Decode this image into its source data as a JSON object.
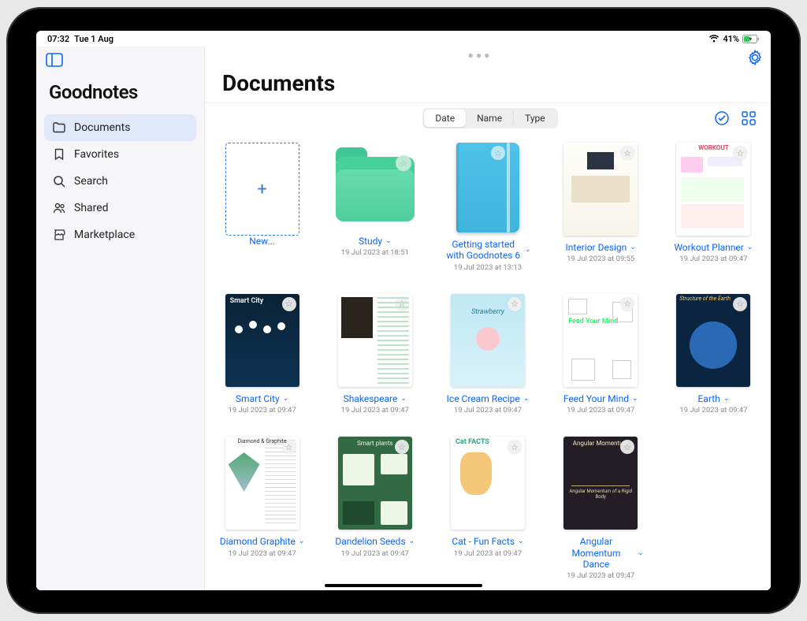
{
  "status": {
    "time": "07:32",
    "date": "Tue 1 Aug",
    "battery": "41%"
  },
  "app_title": "Goodnotes",
  "page_title": "Documents",
  "sidebar": {
    "items": [
      {
        "label": "Documents",
        "icon": "folder-icon",
        "active": true
      },
      {
        "label": "Favorites",
        "icon": "bookmark-icon",
        "active": false
      },
      {
        "label": "Search",
        "icon": "search-icon",
        "active": false
      },
      {
        "label": "Shared",
        "icon": "people-icon",
        "active": false
      },
      {
        "label": "Marketplace",
        "icon": "storefront-icon",
        "active": false
      }
    ]
  },
  "sort_tabs": {
    "options": [
      "Date",
      "Name",
      "Type"
    ],
    "selected": "Date"
  },
  "toolbar": {
    "select_label": "Select",
    "view_grid_label": "Grid"
  },
  "new_item": {
    "label": "New..."
  },
  "documents": [
    {
      "title": "Study",
      "date": "19 Jul 2023 at 18:51",
      "kind": "folder"
    },
    {
      "title": "Getting started with Goodnotes 6",
      "date": "19 Jul 2023 at 13:13",
      "kind": "notebook"
    },
    {
      "title": "Interior Design",
      "date": "19 Jul 2023 at 09:55",
      "kind": "page",
      "variant": "interior"
    },
    {
      "title": "Workout Planner",
      "date": "19 Jul 2023 at 09:47",
      "kind": "page",
      "variant": "workout"
    },
    {
      "title": "Smart City",
      "date": "19 Jul 2023 at 09:47",
      "kind": "page",
      "variant": "smart"
    },
    {
      "title": "Shakespeare",
      "date": "19 Jul 2023 at 09:47",
      "kind": "page",
      "variant": "shakes"
    },
    {
      "title": "Ice Cream Recipe",
      "date": "19 Jul 2023 at 09:47",
      "kind": "page",
      "variant": "ice"
    },
    {
      "title": "Feed Your Mind",
      "date": "19 Jul 2023 at 09:47",
      "kind": "page",
      "variant": "feed"
    },
    {
      "title": "Earth",
      "date": "19 Jul 2023 at 09:47",
      "kind": "page",
      "variant": "earth"
    },
    {
      "title": "Diamond Graphite",
      "date": "19 Jul 2023 at 09:47",
      "kind": "page",
      "variant": "diamond"
    },
    {
      "title": "Dandelion Seeds",
      "date": "19 Jul 2023 at 09:47",
      "kind": "page",
      "variant": "seeds"
    },
    {
      "title": "Cat - Fun Facts",
      "date": "19 Jul 2023 at 09:47",
      "kind": "page",
      "variant": "cat"
    },
    {
      "title": "Angular Momentum Dance",
      "date": "19 Jul 2023 at 09:47",
      "kind": "page",
      "variant": "angmom"
    }
  ]
}
